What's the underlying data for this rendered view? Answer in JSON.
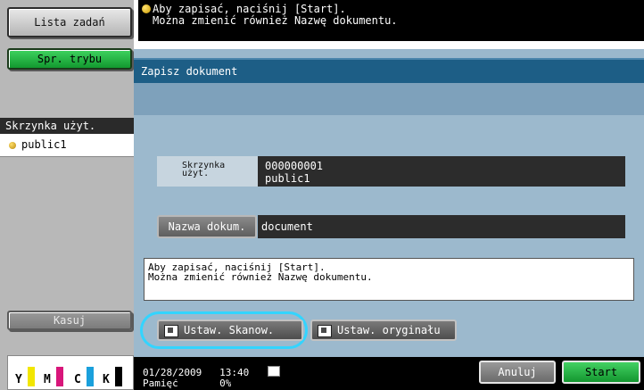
{
  "left_panel": {
    "jobs_button": "Lista zadań",
    "mode_button": "Spr. trybu",
    "box_section": {
      "header": "Skrzynka użyt.",
      "item": "public1"
    },
    "delete_button": "Kasuj",
    "toner": [
      {
        "label": "Y",
        "color": "#f2e600"
      },
      {
        "label": "M",
        "color": "#d8167a"
      },
      {
        "label": "C",
        "color": "#1aa0dc"
      },
      {
        "label": "K",
        "color": "#000000"
      }
    ]
  },
  "top_message": {
    "line1": "Aby zapisać, naciśnij [Start].",
    "line2": "Można zmienić również Nazwę dokumentu."
  },
  "main": {
    "title": "Zapisz dokument",
    "box_label": "Skrzynka użyt.",
    "box_label_line1": "Skrzynka",
    "box_label_line2": "użyt.",
    "box_number": "000000001",
    "box_name": "public1",
    "docname_button": "Nazwa dokum.",
    "docname_value": "document",
    "info_line1": "Aby zapisać, naciśnij [Start].",
    "info_line2": "Można zmienić również Nazwę dokumentu.",
    "scan_settings_button": "Ustaw. Skanow.",
    "original_settings_button": "Ustaw. oryginału"
  },
  "status_bar": {
    "date": "01/28/2009",
    "time": "13:40",
    "memory_label": "Pamięć",
    "memory_value": "0%",
    "cancel_button": "Anuluj",
    "start_button": "Start"
  },
  "colors": {
    "accent_title": "#1d5e86",
    "panel_bg": "#9cb9cd",
    "start_green": "#13962f",
    "highlight": "#33d4ff"
  }
}
